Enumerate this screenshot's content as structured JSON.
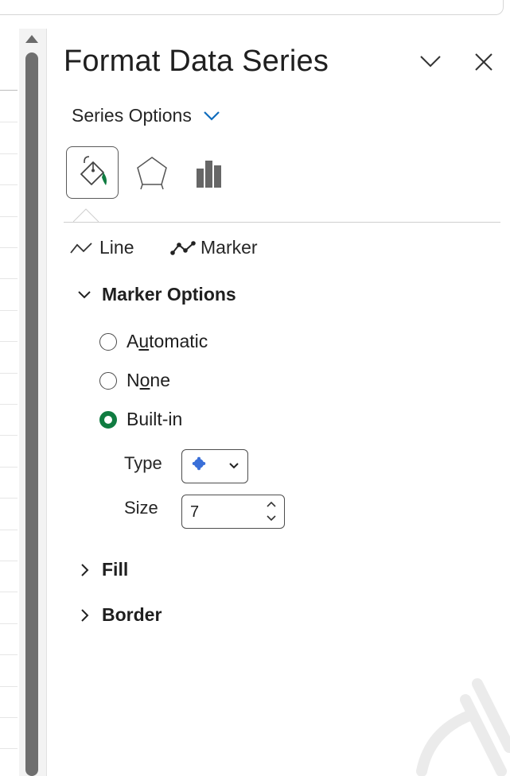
{
  "pane": {
    "title": "Format Data Series",
    "series_options": {
      "label": "Series Options",
      "accent_color": "#0f6cbd"
    },
    "icon_tabs": [
      {
        "name": "fill-and-line",
        "icon": "paint-bucket-icon",
        "selected": true
      },
      {
        "name": "effects",
        "icon": "pentagon-icon",
        "selected": false
      },
      {
        "name": "series-options",
        "icon": "bar-chart-icon",
        "selected": false
      }
    ],
    "subtabs": {
      "line": "Line",
      "marker": "Marker"
    },
    "marker_options": {
      "header": "Marker Options",
      "expanded": true,
      "radios": [
        {
          "pre": "A",
          "ul": "u",
          "post": "tomatic",
          "selected": false
        },
        {
          "pre": "N",
          "ul": "o",
          "post": "ne",
          "selected": false
        },
        {
          "pre": "Built-in",
          "ul": "",
          "post": "",
          "selected": true
        }
      ],
      "type_label": "Type",
      "type_marker_color": "#3a6fd8",
      "size_label": "Size",
      "size_value": "7"
    },
    "fill": {
      "header": "Fill",
      "expanded": false
    },
    "border": {
      "header": "Border",
      "expanded": false
    },
    "selected_color": "#107c41"
  }
}
